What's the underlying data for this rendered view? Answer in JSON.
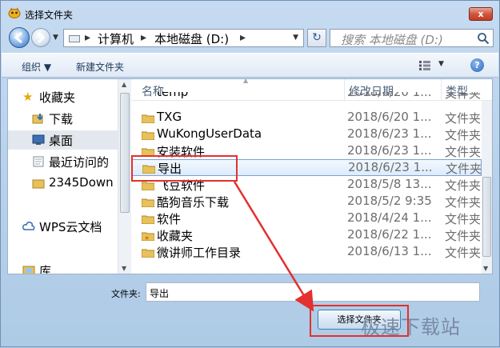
{
  "window": {
    "title": "选择文件夹",
    "close_label": "x"
  },
  "address_bar": {
    "crumbs": [
      "计算机",
      "本地磁盘 (D:)"
    ],
    "separator": "▸"
  },
  "search": {
    "placeholder": "搜索 本地磁盘 (D:)"
  },
  "toolbar": {
    "organize_label": "组织 ▼",
    "new_folder_label": "新建文件夹",
    "help_label": "?"
  },
  "nav_pane": {
    "items": [
      {
        "label": "收藏夹"
      },
      {
        "label": "下载"
      },
      {
        "label": "桌面"
      },
      {
        "label": "最近访问的"
      },
      {
        "label": "2345Down"
      },
      {
        "label": "WPS云文档"
      },
      {
        "label": "库"
      }
    ]
  },
  "file_list": {
    "columns": {
      "name": "名称",
      "date": "修改日期",
      "type": "类型"
    },
    "rows": [
      {
        "name": "temp",
        "date": "2018/6/20 1...",
        "type": "文件夹"
      },
      {
        "name": "TXG",
        "date": "2018/6/20 1...",
        "type": "文件夹"
      },
      {
        "name": "WuKongUserData",
        "date": "2018/6/23 1...",
        "type": "文件夹"
      },
      {
        "name": "安装软件",
        "date": "2018/6/23 1...",
        "type": "文件夹"
      },
      {
        "name": "导出",
        "date": "2018/6/23 1...",
        "type": "文件夹"
      },
      {
        "name": "飞豆软件",
        "date": "2018/5/8 13...",
        "type": "文件夹"
      },
      {
        "name": "酷狗音乐下载",
        "date": "2018/5/2 9:35",
        "type": "文件夹"
      },
      {
        "name": "软件",
        "date": "2018/4/24 1...",
        "type": "文件夹"
      },
      {
        "name": "收藏夹",
        "date": "2018/6/22 1...",
        "type": "文件夹"
      },
      {
        "name": "微讲师工作目录",
        "date": "2018/6/13 1...",
        "type": "文件夹"
      }
    ]
  },
  "folder_field": {
    "label": "文件夹:",
    "value": "导出"
  },
  "select_button": {
    "label": "选择文件夹"
  },
  "watermark": {
    "text": "极速下载站"
  },
  "colors": {
    "annotation_red": "#e2312f",
    "selection": "#dcebfc"
  }
}
